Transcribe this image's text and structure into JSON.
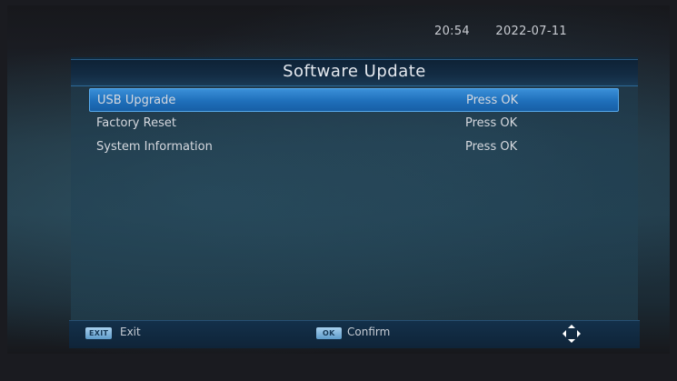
{
  "status_bar": {
    "time": "20:54",
    "date": "2022-07-11"
  },
  "window": {
    "title": "Software Update",
    "items": [
      {
        "label": "USB Upgrade",
        "action": "Press OK",
        "selected": true
      },
      {
        "label": "Factory Reset",
        "action": "Press OK",
        "selected": false
      },
      {
        "label": "System Information",
        "action": "Press OK",
        "selected": false
      }
    ]
  },
  "footer": {
    "exit_key": "EXIT",
    "exit_label": "Exit",
    "ok_key": "OK",
    "ok_label": "Confirm",
    "nav_icon": "directional-pad-icon"
  },
  "colors": {
    "highlight": "#2a7fcf",
    "title_bar": "#132c44"
  }
}
